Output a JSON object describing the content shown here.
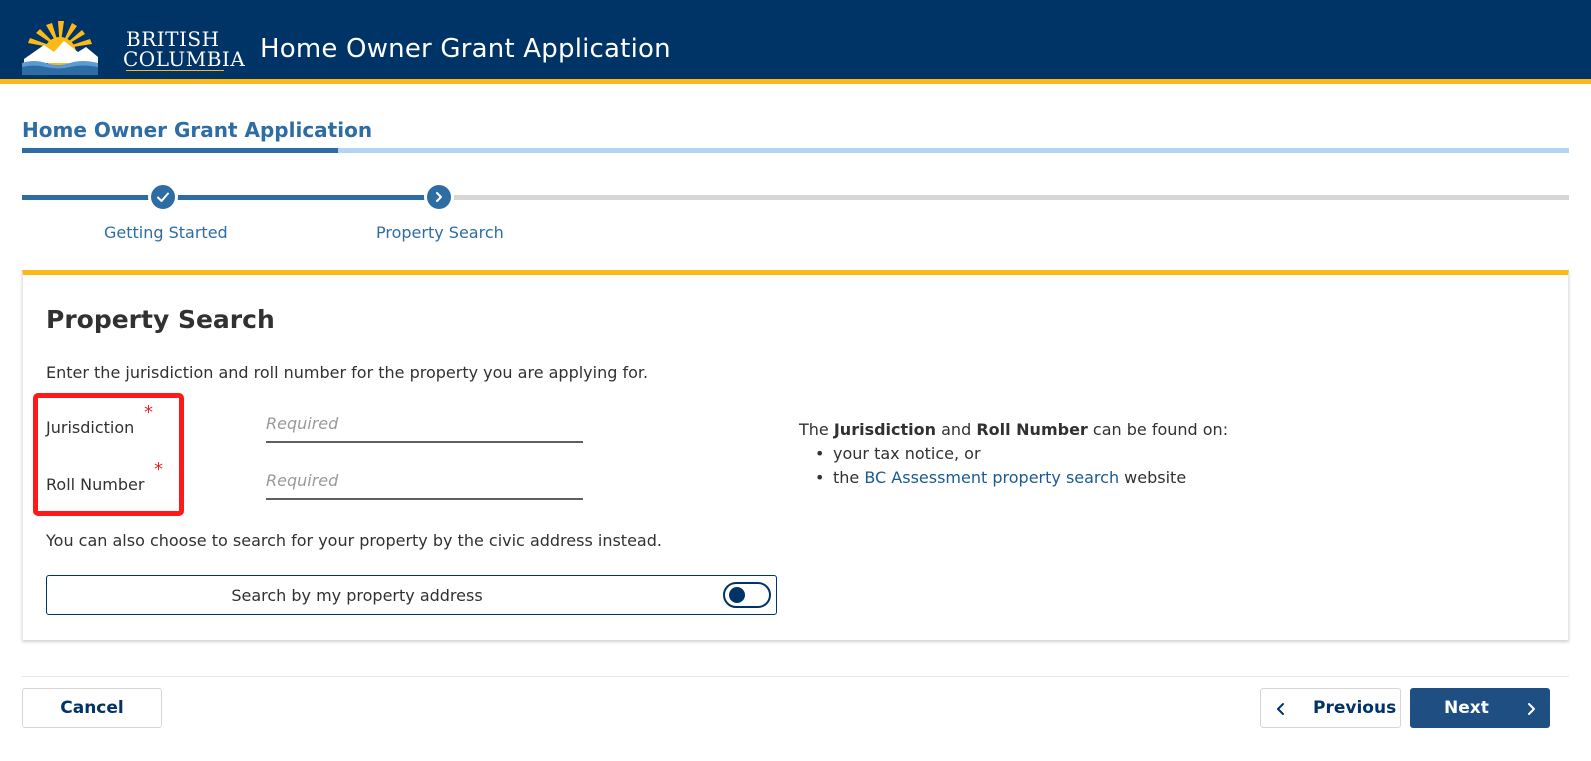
{
  "header": {
    "logo_line1": "BRITISH",
    "logo_line2": "COLUMBIA",
    "title": "Home Owner Grant Application"
  },
  "page": {
    "title": "Home Owner Grant Application"
  },
  "stepper": {
    "steps": [
      {
        "label": "Getting Started",
        "status": "complete",
        "icon": "check-icon"
      },
      {
        "label": "Property Search",
        "status": "current",
        "icon": "chevron-right-icon"
      }
    ]
  },
  "card": {
    "heading": "Property Search",
    "intro": "Enter the jurisdiction and roll number for the property you are applying for.",
    "fields": {
      "jurisdiction": {
        "label": "Jurisdiction",
        "required_marker": "*",
        "placeholder": "Required",
        "value": ""
      },
      "roll_number": {
        "label": "Roll Number",
        "required_marker": "*",
        "placeholder": "Required",
        "value": ""
      }
    },
    "alt_text": "You can also choose to search for your property by the civic address instead.",
    "toggle": {
      "label": "Search by my property address",
      "on": false
    },
    "info": {
      "prefix": "The ",
      "term1": "Jurisdiction",
      "middle": " and ",
      "term2": "Roll Number",
      "suffix": " can be found on:",
      "item1": "your tax notice, or",
      "item2_prefix": "the ",
      "item2_link": "BC Assessment property search",
      "item2_suffix": " website"
    }
  },
  "footer": {
    "cancel_label": "Cancel",
    "previous_label": "Previous",
    "next_label": "Next"
  },
  "colors": {
    "header_bg": "#003366",
    "accent_gold": "#fcba19",
    "primary_blue": "#2e6da4",
    "link_blue": "#1a5a96",
    "required_red": "#d8292f",
    "highlight_red": "#ff1a1a"
  }
}
